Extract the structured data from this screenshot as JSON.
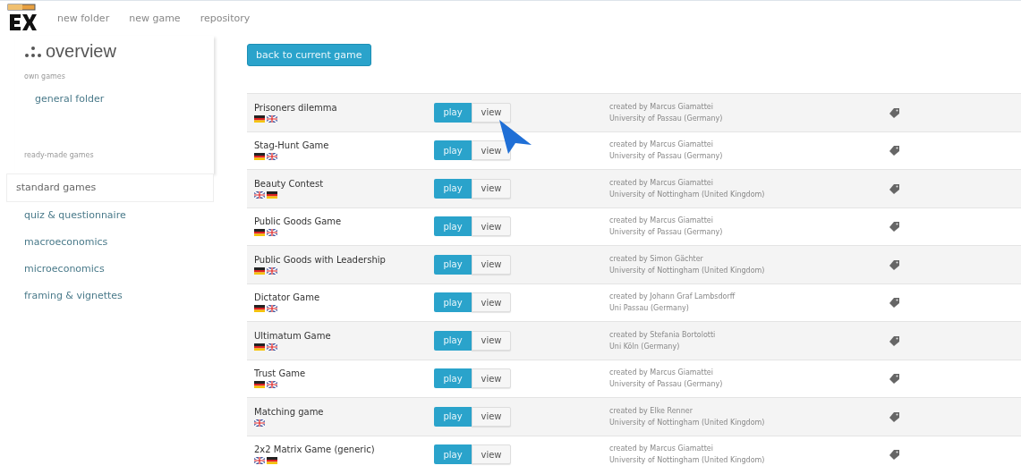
{
  "top_nav": {
    "items": [
      "new folder",
      "new game",
      "repository"
    ]
  },
  "sidebar": {
    "title": "overview",
    "sections": [
      {
        "label": "own games",
        "items": [
          {
            "label": "general folder",
            "selected": false
          }
        ]
      },
      {
        "label": "ready-made games",
        "items": [
          {
            "label": "standard games",
            "selected": true
          },
          {
            "label": "quiz & questionnaire",
            "selected": false
          },
          {
            "label": "macroeconomics",
            "selected": false
          },
          {
            "label": "microeconomics",
            "selected": false
          },
          {
            "label": "framing & vignettes",
            "selected": false
          }
        ]
      }
    ]
  },
  "back_button": "back to current game",
  "games": [
    {
      "name": "Prisoners dilemma",
      "flags": [
        {
          "kind": "de"
        },
        {
          "kind": "en"
        }
      ],
      "play": "play",
      "view": "view",
      "creator": "created by Marcus Giamattei",
      "institution": "University of Passau (Germany)"
    },
    {
      "name": "Stag-Hunt Game",
      "flags": [
        {
          "kind": "de"
        },
        {
          "kind": "en"
        }
      ],
      "play": "play",
      "view": "view",
      "creator": "created by Marcus Giamattei",
      "institution": "University of Passau (Germany)"
    },
    {
      "name": "Beauty Contest",
      "flags": [
        {
          "kind": "en"
        },
        {
          "kind": "de"
        }
      ],
      "play": "play",
      "view": "view",
      "creator": "created by Marcus Giamattei",
      "institution": "University of Nottingham (United Kingdom)"
    },
    {
      "name": "Public Goods Game",
      "flags": [
        {
          "kind": "de"
        },
        {
          "kind": "en"
        }
      ],
      "play": "play",
      "view": "view",
      "creator": "created by Marcus Giamattei",
      "institution": "University of Passau (Germany)"
    },
    {
      "name": "Public Goods with Leadership",
      "flags": [
        {
          "kind": "de"
        },
        {
          "kind": "en"
        }
      ],
      "play": "play",
      "view": "view",
      "creator": "created by Simon Gächter",
      "institution": "University of Nottingham (United Kingdom)"
    },
    {
      "name": "Dictator Game",
      "flags": [
        {
          "kind": "de"
        },
        {
          "kind": "en"
        }
      ],
      "play": "play",
      "view": "view",
      "creator": "created by Johann Graf Lambsdorff",
      "institution": "Uni Passau (Germany)"
    },
    {
      "name": "Ultimatum Game",
      "flags": [
        {
          "kind": "de"
        },
        {
          "kind": "en"
        }
      ],
      "play": "play",
      "view": "view",
      "creator": "created by Stefania Bortolotti",
      "institution": "Uni Köln (Germany)"
    },
    {
      "name": "Trust Game",
      "flags": [
        {
          "kind": "de"
        },
        {
          "kind": "en"
        }
      ],
      "play": "play",
      "view": "view",
      "creator": "created by Marcus Giamattei",
      "institution": "University of Passau (Germany)"
    },
    {
      "name": "Matching game",
      "flags": [
        {
          "kind": "en"
        }
      ],
      "play": "play",
      "view": "view",
      "creator": "created by Elke Renner",
      "institution": "University of Nottingham (United Kingdom)"
    },
    {
      "name": "2x2 Matrix Game (generic)",
      "flags": [
        {
          "kind": "en"
        },
        {
          "kind": "de"
        }
      ],
      "play": "play",
      "view": "view",
      "creator": "created by Marcus Giamattei",
      "institution": "University of Nottingham (United Kingdom)"
    }
  ]
}
